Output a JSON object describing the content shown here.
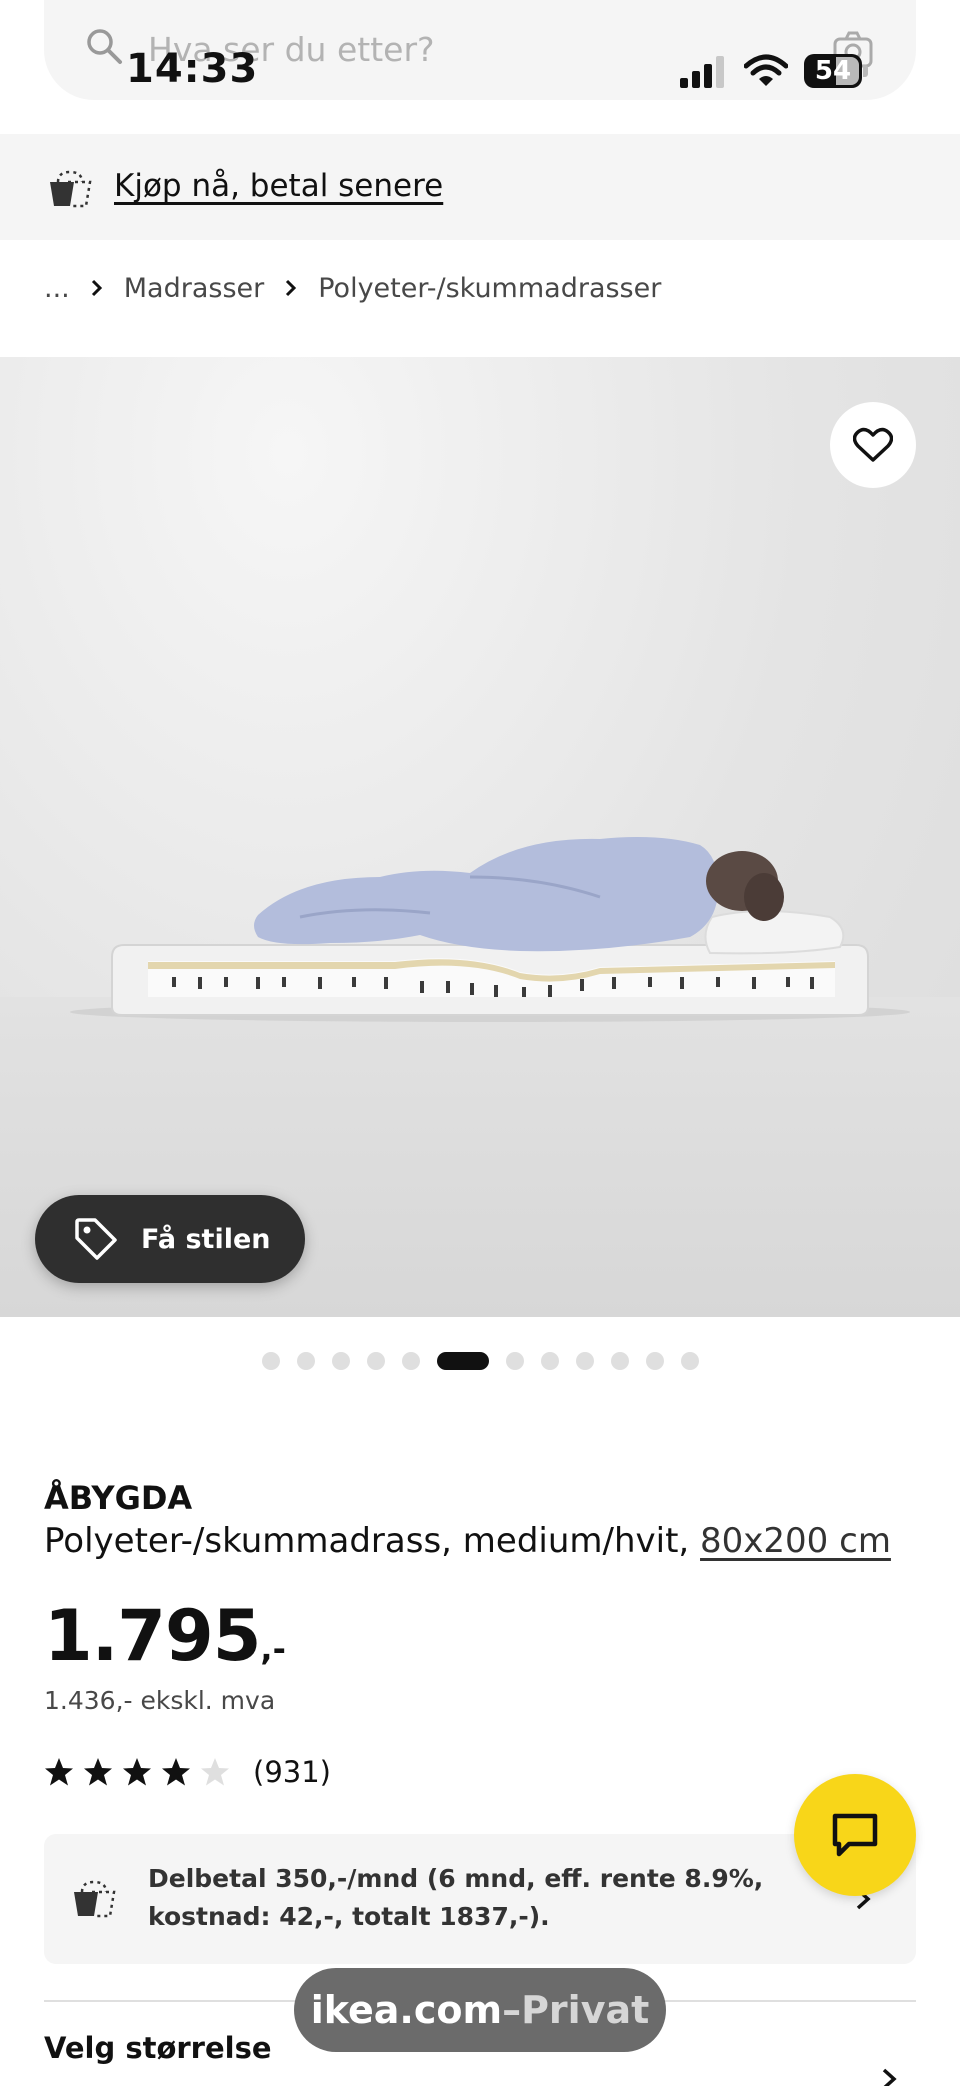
{
  "status_bar": {
    "time": "14:33",
    "battery": "54"
  },
  "search": {
    "placeholder": "Hva ser du etter?",
    "search_icon": "search-icon",
    "camera_icon": "camera-icon"
  },
  "promo": {
    "icon": "payment-bag-icon",
    "link_label": "Kjøp nå, betal senere"
  },
  "breadcrumb": {
    "items": [
      "...",
      "Madrasser",
      "Polyeter-/skummadrasser"
    ]
  },
  "gallery": {
    "style_button_label": "Få stilen",
    "favorite_icon": "heart-icon",
    "total_images": 12,
    "active_index": 5
  },
  "product": {
    "name": "ÅBYGDA",
    "description": "Polyeter-/skummadrass, medium/hvit, ",
    "size_link": "80x200 cm",
    "price_main": "1.795",
    "price_suffix": ",-",
    "price_ex_vat": "1.436,- ekskl. mva",
    "rating_stars": 4,
    "rating_max": 5,
    "review_count": "(931)"
  },
  "installment": {
    "text": "Delbetal 350,-/mnd (6 mnd, eff. rente 8.9%, kostnad: 42,-, totalt 1837,-)."
  },
  "size_section": {
    "heading": "Velg størrelse"
  },
  "browser": {
    "domain": "ikea.com",
    "mode_separator": " – ",
    "mode": "Privat"
  },
  "colors": {
    "accent_yellow": "#f8d619",
    "text_dark": "#111111",
    "panel_grey": "#f5f5f5"
  }
}
